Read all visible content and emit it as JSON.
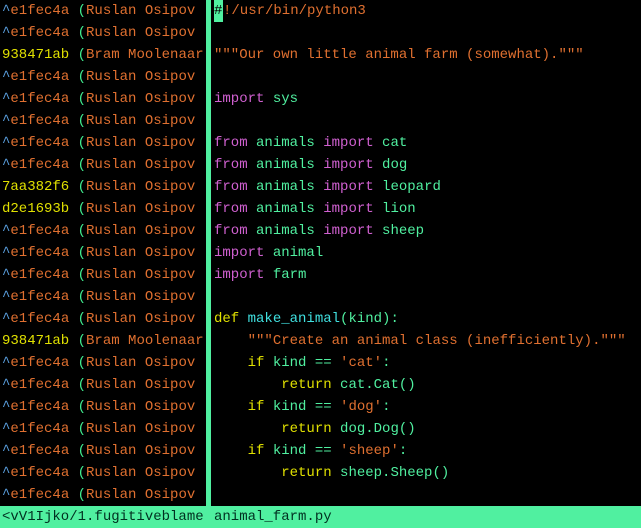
{
  "blame": [
    {
      "caret": "^",
      "hash": "e1fec4a",
      "author": "Ruslan Osipov",
      "hashClass": "hash"
    },
    {
      "caret": "^",
      "hash": "e1fec4a",
      "author": "Ruslan Osipov",
      "hashClass": "hash"
    },
    {
      "caret": "",
      "hash": "938471ab",
      "author": "Bram Moolenaar",
      "hashClass": "hash-new"
    },
    {
      "caret": "^",
      "hash": "e1fec4a",
      "author": "Ruslan Osipov",
      "hashClass": "hash"
    },
    {
      "caret": "^",
      "hash": "e1fec4a",
      "author": "Ruslan Osipov",
      "hashClass": "hash"
    },
    {
      "caret": "^",
      "hash": "e1fec4a",
      "author": "Ruslan Osipov",
      "hashClass": "hash"
    },
    {
      "caret": "^",
      "hash": "e1fec4a",
      "author": "Ruslan Osipov",
      "hashClass": "hash"
    },
    {
      "caret": "^",
      "hash": "e1fec4a",
      "author": "Ruslan Osipov",
      "hashClass": "hash"
    },
    {
      "caret": "",
      "hash": "7aa382f6",
      "author": "Ruslan Osipov",
      "hashClass": "hash-new"
    },
    {
      "caret": "",
      "hash": "d2e1693b",
      "author": "Ruslan Osipov",
      "hashClass": "hash-new"
    },
    {
      "caret": "^",
      "hash": "e1fec4a",
      "author": "Ruslan Osipov",
      "hashClass": "hash"
    },
    {
      "caret": "^",
      "hash": "e1fec4a",
      "author": "Ruslan Osipov",
      "hashClass": "hash"
    },
    {
      "caret": "^",
      "hash": "e1fec4a",
      "author": "Ruslan Osipov",
      "hashClass": "hash"
    },
    {
      "caret": "^",
      "hash": "e1fec4a",
      "author": "Ruslan Osipov",
      "hashClass": "hash"
    },
    {
      "caret": "^",
      "hash": "e1fec4a",
      "author": "Ruslan Osipov",
      "hashClass": "hash"
    },
    {
      "caret": "",
      "hash": "938471ab",
      "author": "Bram Moolenaar",
      "hashClass": "hash-new"
    },
    {
      "caret": "^",
      "hash": "e1fec4a",
      "author": "Ruslan Osipov",
      "hashClass": "hash"
    },
    {
      "caret": "^",
      "hash": "e1fec4a",
      "author": "Ruslan Osipov",
      "hashClass": "hash"
    },
    {
      "caret": "^",
      "hash": "e1fec4a",
      "author": "Ruslan Osipov",
      "hashClass": "hash"
    },
    {
      "caret": "^",
      "hash": "e1fec4a",
      "author": "Ruslan Osipov",
      "hashClass": "hash"
    },
    {
      "caret": "^",
      "hash": "e1fec4a",
      "author": "Ruslan Osipov",
      "hashClass": "hash"
    },
    {
      "caret": "^",
      "hash": "e1fec4a",
      "author": "Ruslan Osipov",
      "hashClass": "hash"
    },
    {
      "caret": "^",
      "hash": "e1fec4a",
      "author": "Ruslan Osipov",
      "hashClass": "hash"
    }
  ],
  "code": [
    {
      "segments": [
        {
          "t": "#",
          "cls": "cursor"
        },
        {
          "t": "!/usr/bin/python3",
          "cls": "c-str"
        }
      ]
    },
    {
      "segments": []
    },
    {
      "segments": [
        {
          "t": "\"\"\"Our own little animal farm (somewhat).\"\"\"",
          "cls": "c-str"
        }
      ]
    },
    {
      "segments": []
    },
    {
      "segments": [
        {
          "t": "import",
          "cls": "c-import"
        },
        {
          "t": " sys",
          "cls": "c-ident"
        }
      ]
    },
    {
      "segments": []
    },
    {
      "segments": [
        {
          "t": "from",
          "cls": "c-import"
        },
        {
          "t": " animals ",
          "cls": "c-ident"
        },
        {
          "t": "import",
          "cls": "c-import"
        },
        {
          "t": " cat",
          "cls": "c-ident"
        }
      ]
    },
    {
      "segments": [
        {
          "t": "from",
          "cls": "c-import"
        },
        {
          "t": " animals ",
          "cls": "c-ident"
        },
        {
          "t": "import",
          "cls": "c-import"
        },
        {
          "t": " dog",
          "cls": "c-ident"
        }
      ]
    },
    {
      "segments": [
        {
          "t": "from",
          "cls": "c-import"
        },
        {
          "t": " animals ",
          "cls": "c-ident"
        },
        {
          "t": "import",
          "cls": "c-import"
        },
        {
          "t": " leopard",
          "cls": "c-ident"
        }
      ]
    },
    {
      "segments": [
        {
          "t": "from",
          "cls": "c-import"
        },
        {
          "t": " animals ",
          "cls": "c-ident"
        },
        {
          "t": "import",
          "cls": "c-import"
        },
        {
          "t": " lion",
          "cls": "c-ident"
        }
      ]
    },
    {
      "segments": [
        {
          "t": "from",
          "cls": "c-import"
        },
        {
          "t": " animals ",
          "cls": "c-ident"
        },
        {
          "t": "import",
          "cls": "c-import"
        },
        {
          "t": " sheep",
          "cls": "c-ident"
        }
      ]
    },
    {
      "segments": [
        {
          "t": "import",
          "cls": "c-import"
        },
        {
          "t": " animal",
          "cls": "c-ident"
        }
      ]
    },
    {
      "segments": [
        {
          "t": "import",
          "cls": "c-import"
        },
        {
          "t": " farm",
          "cls": "c-ident"
        }
      ]
    },
    {
      "segments": []
    },
    {
      "segments": [
        {
          "t": "def",
          "cls": "c-kw"
        },
        {
          "t": " ",
          "cls": "c-ident"
        },
        {
          "t": "make_animal",
          "cls": "c-def"
        },
        {
          "t": "(kind):",
          "cls": "c-ident"
        }
      ]
    },
    {
      "segments": [
        {
          "t": "    ",
          "cls": "c-ident"
        },
        {
          "t": "\"\"\"Create an animal class (inefficiently).\"\"\"",
          "cls": "c-str"
        }
      ]
    },
    {
      "segments": [
        {
          "t": "    ",
          "cls": "c-ident"
        },
        {
          "t": "if",
          "cls": "c-kw"
        },
        {
          "t": " kind == ",
          "cls": "c-ident"
        },
        {
          "t": "'cat'",
          "cls": "c-str"
        },
        {
          "t": ":",
          "cls": "c-ident"
        }
      ]
    },
    {
      "segments": [
        {
          "t": "        ",
          "cls": "c-ident"
        },
        {
          "t": "return",
          "cls": "c-kw"
        },
        {
          "t": " cat.Cat()",
          "cls": "c-ident"
        }
      ]
    },
    {
      "segments": [
        {
          "t": "    ",
          "cls": "c-ident"
        },
        {
          "t": "if",
          "cls": "c-kw"
        },
        {
          "t": " kind == ",
          "cls": "c-ident"
        },
        {
          "t": "'dog'",
          "cls": "c-str"
        },
        {
          "t": ":",
          "cls": "c-ident"
        }
      ]
    },
    {
      "segments": [
        {
          "t": "        ",
          "cls": "c-ident"
        },
        {
          "t": "return",
          "cls": "c-kw"
        },
        {
          "t": " dog.Dog()",
          "cls": "c-ident"
        }
      ]
    },
    {
      "segments": [
        {
          "t": "    ",
          "cls": "c-ident"
        },
        {
          "t": "if",
          "cls": "c-kw"
        },
        {
          "t": " kind == ",
          "cls": "c-ident"
        },
        {
          "t": "'sheep'",
          "cls": "c-str"
        },
        {
          "t": ":",
          "cls": "c-ident"
        }
      ]
    },
    {
      "segments": [
        {
          "t": "        ",
          "cls": "c-ident"
        },
        {
          "t": "return",
          "cls": "c-kw"
        },
        {
          "t": " sheep.Sheep()",
          "cls": "c-ident"
        }
      ]
    }
  ],
  "status": {
    "left": "<vV1Ijko/1.fugitiveblame",
    "right": "animal_farm.py"
  }
}
